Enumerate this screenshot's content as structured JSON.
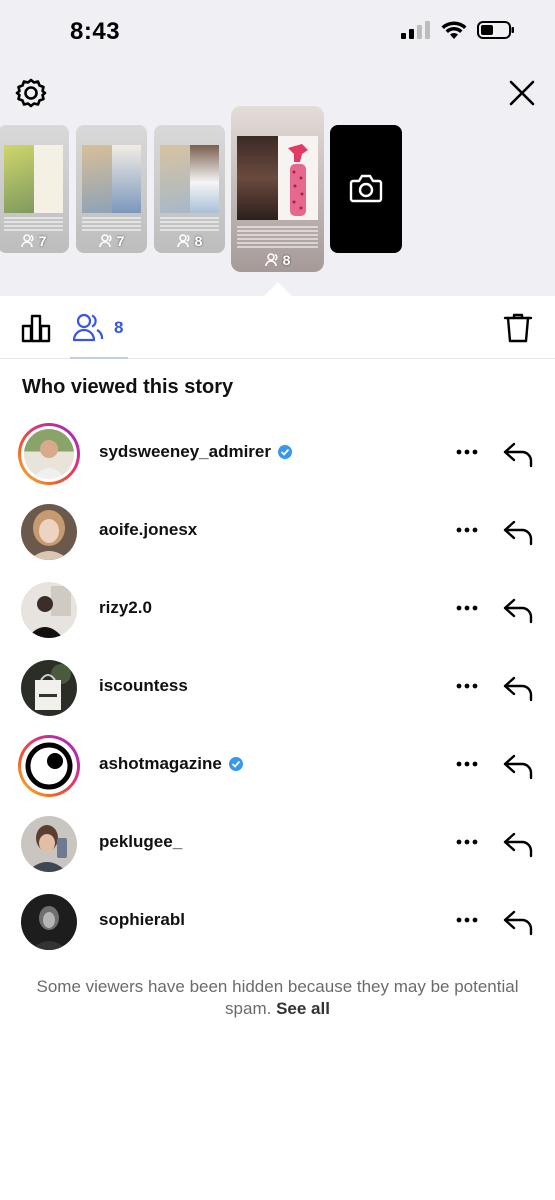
{
  "status_bar": {
    "time": "8:43"
  },
  "stories": [
    {
      "viewers": "7"
    },
    {
      "viewers": "7"
    },
    {
      "viewers": "8"
    },
    {
      "viewers": "8",
      "selected": true
    }
  ],
  "tabs": {
    "viewers_count": "8"
  },
  "section_title": "Who viewed this story",
  "viewers": [
    {
      "username": "sydsweeney_admirer",
      "verified": true
    },
    {
      "username": "aoife.jonesx",
      "verified": false
    },
    {
      "username": "rizy2.0",
      "verified": false
    },
    {
      "username": "iscountess",
      "verified": false
    },
    {
      "username": "ashotmagazine",
      "verified": true
    },
    {
      "username": "peklugee_",
      "verified": false
    },
    {
      "username": "sophierabl",
      "verified": false
    }
  ],
  "footnote": {
    "text": "Some viewers have been hidden because they may be potential spam.",
    "link": "See all"
  },
  "colors": {
    "accent": "#3a55e6",
    "verified": "#3897f0",
    "background_top": "#efeff4"
  },
  "icons": [
    "settings-gear-icon",
    "close-icon",
    "camera-icon",
    "bar-chart-icon",
    "viewers-icon",
    "trash-icon",
    "more-icon",
    "reply-icon",
    "verified-badge-icon"
  ]
}
